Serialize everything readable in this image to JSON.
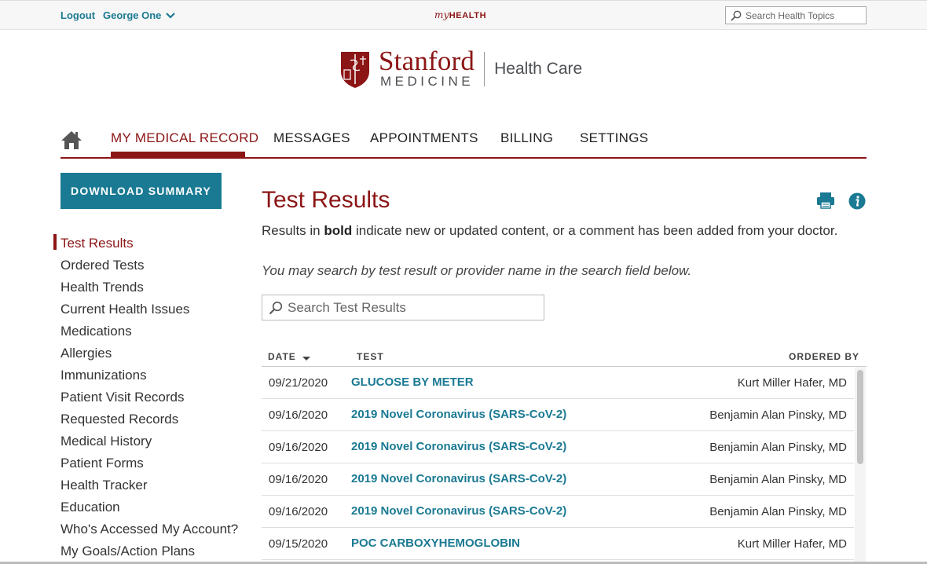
{
  "topbar": {
    "logout": "Logout",
    "user": "George One",
    "brand_prefix": "my",
    "brand_suffix": "HEALTH",
    "search_placeholder": "Search Health Topics"
  },
  "logo": {
    "line1": "Stanford",
    "line2": "MEDICINE",
    "side": "Health Care"
  },
  "nav": {
    "items": [
      "MY MEDICAL RECORD",
      "MESSAGES",
      "APPOINTMENTS",
      "BILLING",
      "SETTINGS"
    ],
    "active": "MY MEDICAL RECORD"
  },
  "sidebar": {
    "download": "DOWNLOAD SUMMARY",
    "items": [
      "Test Results",
      "Ordered Tests",
      "Health Trends",
      "Current Health Issues",
      "Medications",
      "Allergies",
      "Immunizations",
      "Patient Visit Records",
      "Requested Records",
      "Medical History",
      "Patient Forms",
      "Health Tracker",
      "Education",
      "Who's Accessed My Account?",
      "My Goals/Action Plans"
    ],
    "active": "Test Results"
  },
  "main": {
    "title": "Test Results",
    "intro_before": "Results in ",
    "intro_bold": "bold",
    "intro_after": " indicate new or updated content, or a comment has been added from your doctor.",
    "hint": "You may search by test result or provider name in the search field below.",
    "search_placeholder": "Search Test Results",
    "columns": {
      "date": "DATE",
      "test": "TEST",
      "ordered_by": "ORDERED BY"
    },
    "rows": [
      {
        "date": "09/21/2020",
        "test": "GLUCOSE BY METER",
        "ordered_by": "Kurt Miller Hafer, MD"
      },
      {
        "date": "09/16/2020",
        "test": "2019 Novel Coronavirus (SARS-CoV-2)",
        "ordered_by": "Benjamin Alan Pinsky, MD"
      },
      {
        "date": "09/16/2020",
        "test": "2019 Novel Coronavirus (SARS-CoV-2)",
        "ordered_by": "Benjamin Alan Pinsky, MD"
      },
      {
        "date": "09/16/2020",
        "test": "2019 Novel Coronavirus (SARS-CoV-2)",
        "ordered_by": "Benjamin Alan Pinsky, MD"
      },
      {
        "date": "09/16/2020",
        "test": "2019 Novel Coronavirus (SARS-CoV-2)",
        "ordered_by": "Benjamin Alan Pinsky, MD"
      },
      {
        "date": "09/15/2020",
        "test": "POC CARBOXYHEMOGLOBIN",
        "ordered_by": "Kurt Miller Hafer, MD"
      }
    ]
  },
  "colors": {
    "brand_red": "#8c1515",
    "teal": "#1a7a93"
  }
}
